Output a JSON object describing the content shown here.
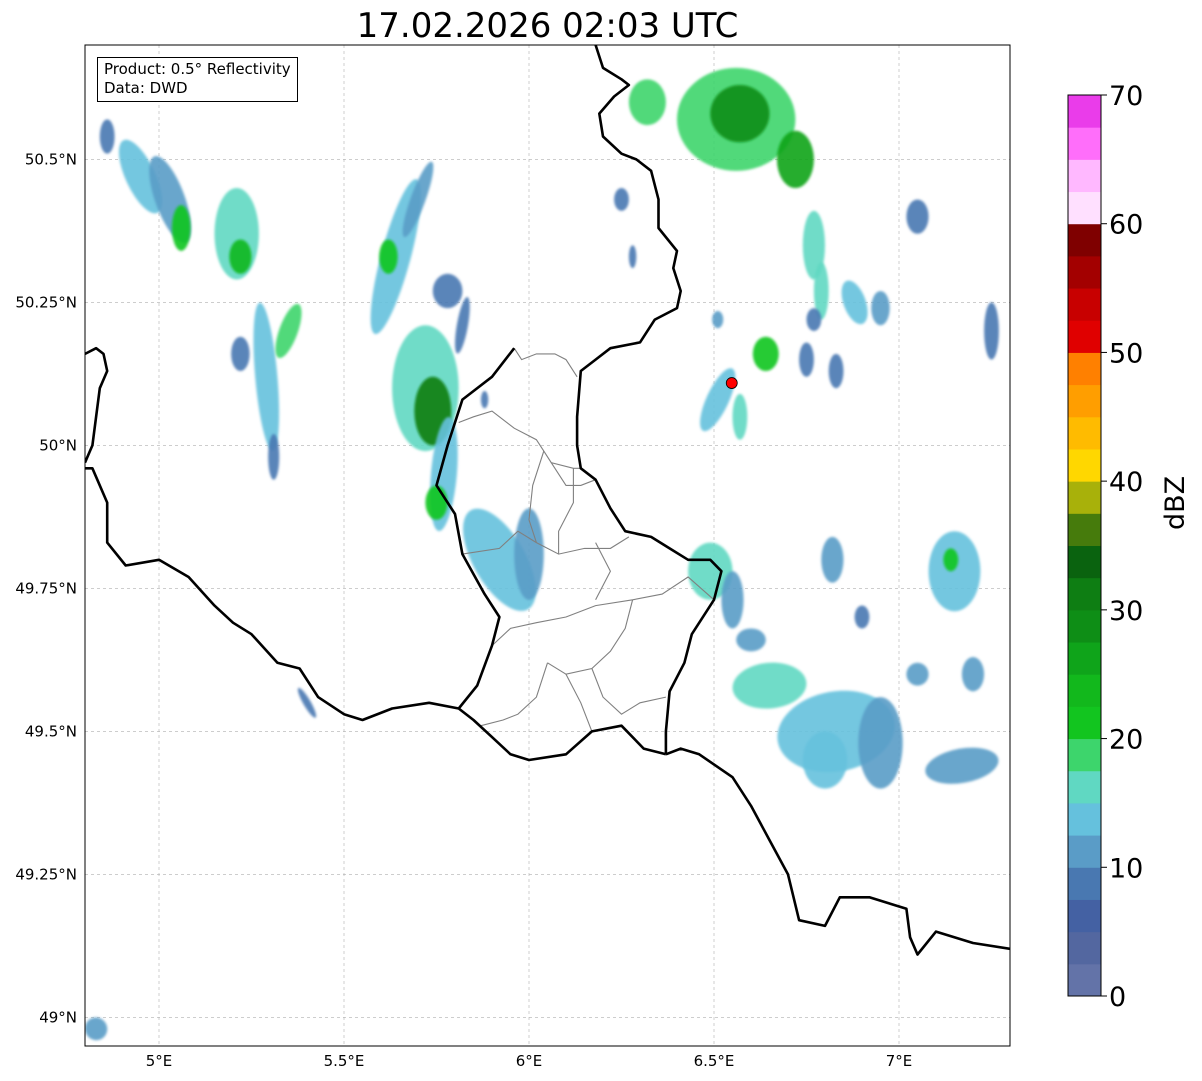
{
  "title": "17.02.2026 02:03 UTC",
  "info_box": {
    "product": "Product: 0.5° Reflectivity",
    "data": "Data: DWD"
  },
  "map": {
    "lon_range": [
      4.8,
      7.3
    ],
    "lat_range": [
      48.95,
      50.7
    ],
    "x_ticks": [
      {
        "value": 5.0,
        "label": "5°E"
      },
      {
        "value": 5.5,
        "label": "5.5°E"
      },
      {
        "value": 6.0,
        "label": "6°E"
      },
      {
        "value": 6.5,
        "label": "6.5°E"
      },
      {
        "value": 7.0,
        "label": "7°E"
      }
    ],
    "y_ticks": [
      {
        "value": 50.5,
        "label": "50.5°N"
      },
      {
        "value": 50.25,
        "label": "50.25°N"
      },
      {
        "value": 50.0,
        "label": "50°N"
      },
      {
        "value": 49.75,
        "label": "49.75°N"
      },
      {
        "value": 49.5,
        "label": "49.5°N"
      },
      {
        "value": 49.25,
        "label": "49.25°N"
      },
      {
        "value": 49.0,
        "label": "49°N"
      }
    ],
    "grid": true,
    "radar_site": {
      "lon": 6.548,
      "lat": 50.109,
      "color": "#ff0000"
    },
    "country_borders": [
      [
        [
          6.18,
          50.7
        ],
        [
          6.2,
          50.66
        ],
        [
          6.25,
          50.64
        ],
        [
          6.27,
          50.63
        ],
        [
          6.23,
          50.61
        ],
        [
          6.19,
          50.58
        ],
        [
          6.2,
          50.54
        ],
        [
          6.25,
          50.51
        ],
        [
          6.29,
          50.5
        ],
        [
          6.33,
          50.48
        ],
        [
          6.35,
          50.43
        ],
        [
          6.35,
          50.38
        ],
        [
          6.4,
          50.34
        ],
        [
          6.39,
          50.31
        ],
        [
          6.41,
          50.27
        ],
        [
          6.4,
          50.24
        ],
        [
          6.34,
          50.22
        ],
        [
          6.3,
          50.18
        ],
        [
          6.22,
          50.17
        ],
        [
          6.18,
          50.15
        ],
        [
          6.14,
          50.13
        ],
        [
          6.13,
          50.05
        ],
        [
          6.13,
          50.0
        ],
        [
          6.14,
          49.96
        ],
        [
          6.18,
          49.94
        ],
        [
          6.22,
          49.89
        ],
        [
          6.26,
          49.85
        ],
        [
          6.33,
          49.84
        ],
        [
          6.38,
          49.82
        ],
        [
          6.43,
          49.8
        ],
        [
          6.49,
          49.8
        ],
        [
          6.52,
          49.78
        ],
        [
          6.5,
          49.73
        ],
        [
          6.44,
          49.67
        ],
        [
          6.42,
          49.62
        ],
        [
          6.38,
          49.57
        ],
        [
          6.37,
          49.5
        ],
        [
          6.37,
          49.46
        ]
      ],
      [
        [
          6.37,
          49.46
        ],
        [
          6.31,
          49.47
        ],
        [
          6.25,
          49.51
        ],
        [
          6.17,
          49.5
        ],
        [
          6.1,
          49.46
        ],
        [
          6.0,
          49.45
        ],
        [
          5.95,
          49.46
        ],
        [
          5.9,
          49.49
        ],
        [
          5.85,
          49.52
        ],
        [
          5.81,
          49.54
        ],
        [
          5.73,
          49.55
        ],
        [
          5.63,
          49.54
        ],
        [
          5.55,
          49.52
        ],
        [
          5.5,
          49.53
        ],
        [
          5.43,
          49.56
        ],
        [
          5.38,
          49.61
        ],
        [
          5.32,
          49.62
        ],
        [
          5.25,
          49.67
        ],
        [
          5.2,
          49.69
        ],
        [
          5.15,
          49.72
        ],
        [
          5.08,
          49.77
        ],
        [
          5.0,
          49.8
        ],
        [
          4.91,
          49.79
        ],
        [
          4.86,
          49.83
        ],
        [
          4.86,
          49.9
        ],
        [
          4.82,
          49.96
        ],
        [
          4.8,
          49.96
        ]
      ],
      [
        [
          5.96,
          50.17
        ],
        [
          5.9,
          50.12
        ],
        [
          5.82,
          50.08
        ],
        [
          5.78,
          50.0
        ],
        [
          5.75,
          49.93
        ],
        [
          5.8,
          49.88
        ],
        [
          5.82,
          49.81
        ],
        [
          5.88,
          49.74
        ],
        [
          5.92,
          49.7
        ],
        [
          5.9,
          49.65
        ],
        [
          5.86,
          49.58
        ],
        [
          5.81,
          49.54
        ]
      ],
      [
        [
          4.8,
          50.16
        ],
        [
          4.83,
          50.17
        ],
        [
          4.85,
          50.16
        ],
        [
          4.86,
          50.13
        ],
        [
          4.84,
          50.1
        ],
        [
          4.83,
          50.05
        ],
        [
          4.82,
          50.0
        ],
        [
          4.8,
          49.97
        ]
      ],
      [
        [
          6.37,
          49.46
        ],
        [
          6.41,
          49.47
        ],
        [
          6.46,
          49.46
        ],
        [
          6.55,
          49.42
        ],
        [
          6.6,
          49.37
        ],
        [
          6.65,
          49.31
        ],
        [
          6.7,
          49.25
        ],
        [
          6.73,
          49.17
        ],
        [
          6.8,
          49.16
        ],
        [
          6.84,
          49.21
        ],
        [
          6.92,
          49.21
        ],
        [
          6.97,
          49.2
        ],
        [
          7.02,
          49.19
        ],
        [
          7.03,
          49.14
        ],
        [
          7.05,
          49.11
        ],
        [
          7.1,
          49.15
        ],
        [
          7.2,
          49.13
        ],
        [
          7.3,
          49.12
        ]
      ]
    ],
    "internal_borders": [
      [
        [
          5.96,
          50.17
        ],
        [
          5.98,
          50.15
        ],
        [
          6.02,
          50.16
        ],
        [
          6.07,
          50.16
        ],
        [
          6.1,
          50.15
        ],
        [
          6.13,
          50.12
        ]
      ],
      [
        [
          5.81,
          50.04
        ],
        [
          5.85,
          50.05
        ],
        [
          5.9,
          50.06
        ],
        [
          5.92,
          50.05
        ],
        [
          5.96,
          50.03
        ],
        [
          6.02,
          50.01
        ],
        [
          6.04,
          49.99
        ],
        [
          6.06,
          49.97
        ],
        [
          6.12,
          49.96
        ],
        [
          6.14,
          49.96
        ]
      ],
      [
        [
          6.06,
          49.97
        ],
        [
          6.1,
          49.93
        ],
        [
          6.14,
          49.93
        ],
        [
          6.18,
          49.94
        ]
      ],
      [
        [
          5.82,
          49.81
        ],
        [
          5.92,
          49.82
        ],
        [
          5.97,
          49.85
        ],
        [
          6.02,
          49.83
        ],
        [
          6.08,
          49.81
        ],
        [
          6.15,
          49.82
        ],
        [
          6.22,
          49.82
        ],
        [
          6.27,
          49.84
        ]
      ],
      [
        [
          6.04,
          49.99
        ],
        [
          6.01,
          49.93
        ],
        [
          6.0,
          49.87
        ],
        [
          6.02,
          49.83
        ]
      ],
      [
        [
          5.9,
          49.65
        ],
        [
          5.95,
          49.68
        ],
        [
          6.02,
          49.69
        ],
        [
          6.1,
          49.7
        ],
        [
          6.18,
          49.72
        ],
        [
          6.28,
          49.73
        ],
        [
          6.36,
          49.74
        ],
        [
          6.43,
          49.77
        ],
        [
          6.5,
          49.73
        ]
      ],
      [
        [
          6.28,
          49.73
        ],
        [
          6.26,
          49.68
        ],
        [
          6.22,
          49.64
        ],
        [
          6.17,
          49.61
        ],
        [
          6.1,
          49.6
        ],
        [
          6.05,
          49.62
        ]
      ],
      [
        [
          6.17,
          49.61
        ],
        [
          6.2,
          49.56
        ],
        [
          6.25,
          49.53
        ],
        [
          6.3,
          49.55
        ],
        [
          6.37,
          49.56
        ]
      ],
      [
        [
          6.05,
          49.62
        ],
        [
          6.02,
          49.56
        ],
        [
          5.97,
          49.53
        ],
        [
          5.93,
          49.52
        ],
        [
          5.87,
          49.51
        ]
      ],
      [
        [
          6.1,
          49.6
        ],
        [
          6.14,
          49.55
        ],
        [
          6.17,
          49.5
        ]
      ],
      [
        [
          6.18,
          49.83
        ],
        [
          6.22,
          49.78
        ],
        [
          6.18,
          49.73
        ]
      ],
      [
        [
          6.12,
          49.96
        ],
        [
          6.12,
          49.9
        ],
        [
          6.08,
          49.85
        ],
        [
          6.08,
          49.81
        ]
      ]
    ],
    "echoes": [
      {
        "lon": 4.95,
        "lat": 50.47,
        "rx": 0.04,
        "ry": 0.07,
        "rot": -25,
        "dbz": 14
      },
      {
        "lon": 5.03,
        "lat": 50.43,
        "rx": 0.04,
        "ry": 0.08,
        "rot": -20,
        "dbz": 12
      },
      {
        "lon": 5.06,
        "lat": 50.38,
        "rx": 0.025,
        "ry": 0.04,
        "rot": 0,
        "dbz": 20
      },
      {
        "lon": 4.86,
        "lat": 50.54,
        "rx": 0.02,
        "ry": 0.03,
        "rot": 0,
        "dbz": 8
      },
      {
        "lon": 5.21,
        "lat": 50.37,
        "rx": 0.06,
        "ry": 0.08,
        "rot": 0,
        "dbz": 15
      },
      {
        "lon": 5.22,
        "lat": 50.33,
        "rx": 0.03,
        "ry": 0.03,
        "rot": 0,
        "dbz": 23
      },
      {
        "lon": 5.29,
        "lat": 50.12,
        "rx": 0.03,
        "ry": 0.13,
        "rot": -5,
        "dbz": 14
      },
      {
        "lon": 5.22,
        "lat": 50.16,
        "rx": 0.025,
        "ry": 0.03,
        "rot": 0,
        "dbz": 8
      },
      {
        "lon": 5.35,
        "lat": 50.2,
        "rx": 0.025,
        "ry": 0.05,
        "rot": 20,
        "dbz": 18
      },
      {
        "lon": 5.31,
        "lat": 49.98,
        "rx": 0.015,
        "ry": 0.04,
        "rot": 0,
        "dbz": 8
      },
      {
        "lon": 5.64,
        "lat": 50.33,
        "rx": 0.04,
        "ry": 0.14,
        "rot": 15,
        "dbz": 13
      },
      {
        "lon": 5.62,
        "lat": 50.33,
        "rx": 0.025,
        "ry": 0.03,
        "rot": 0,
        "dbz": 21
      },
      {
        "lon": 5.7,
        "lat": 50.43,
        "rx": 0.02,
        "ry": 0.07,
        "rot": 20,
        "dbz": 10
      },
      {
        "lon": 5.72,
        "lat": 50.1,
        "rx": 0.09,
        "ry": 0.11,
        "rot": 0,
        "dbz": 16
      },
      {
        "lon": 5.74,
        "lat": 50.06,
        "rx": 0.05,
        "ry": 0.06,
        "rot": 0,
        "dbz": 30
      },
      {
        "lon": 5.77,
        "lat": 49.95,
        "rx": 0.035,
        "ry": 0.1,
        "rot": 5,
        "dbz": 14
      },
      {
        "lon": 5.75,
        "lat": 49.9,
        "rx": 0.03,
        "ry": 0.03,
        "rot": 0,
        "dbz": 21
      },
      {
        "lon": 5.92,
        "lat": 49.8,
        "rx": 0.07,
        "ry": 0.1,
        "rot": -30,
        "dbz": 13
      },
      {
        "lon": 6.0,
        "lat": 49.81,
        "rx": 0.04,
        "ry": 0.08,
        "rot": 0,
        "dbz": 12
      },
      {
        "lon": 5.78,
        "lat": 50.27,
        "rx": 0.04,
        "ry": 0.03,
        "rot": 0,
        "dbz": 8
      },
      {
        "lon": 5.82,
        "lat": 50.21,
        "rx": 0.015,
        "ry": 0.05,
        "rot": 10,
        "dbz": 8
      },
      {
        "lon": 6.56,
        "lat": 50.57,
        "rx": 0.16,
        "ry": 0.09,
        "rot": 0,
        "dbz": 18
      },
      {
        "lon": 6.57,
        "lat": 50.58,
        "rx": 0.08,
        "ry": 0.05,
        "rot": 0,
        "dbz": 28
      },
      {
        "lon": 6.72,
        "lat": 50.5,
        "rx": 0.05,
        "ry": 0.05,
        "rot": 0,
        "dbz": 27
      },
      {
        "lon": 6.32,
        "lat": 50.6,
        "rx": 0.05,
        "ry": 0.04,
        "rot": 0,
        "dbz": 18
      },
      {
        "lon": 6.77,
        "lat": 50.35,
        "rx": 0.03,
        "ry": 0.06,
        "rot": 0,
        "dbz": 15
      },
      {
        "lon": 6.79,
        "lat": 50.27,
        "rx": 0.02,
        "ry": 0.05,
        "rot": 0,
        "dbz": 16
      },
      {
        "lon": 6.88,
        "lat": 50.25,
        "rx": 0.03,
        "ry": 0.04,
        "rot": -20,
        "dbz": 14
      },
      {
        "lon": 6.95,
        "lat": 50.24,
        "rx": 0.025,
        "ry": 0.03,
        "rot": 0,
        "dbz": 10
      },
      {
        "lon": 7.05,
        "lat": 50.4,
        "rx": 0.03,
        "ry": 0.03,
        "rot": 0,
        "dbz": 8
      },
      {
        "lon": 6.64,
        "lat": 50.16,
        "rx": 0.035,
        "ry": 0.03,
        "rot": 0,
        "dbz": 20
      },
      {
        "lon": 6.51,
        "lat": 50.22,
        "rx": 0.015,
        "ry": 0.015,
        "rot": 0,
        "dbz": 12
      },
      {
        "lon": 6.51,
        "lat": 50.08,
        "rx": 0.03,
        "ry": 0.06,
        "rot": 25,
        "dbz": 14
      },
      {
        "lon": 6.57,
        "lat": 50.05,
        "rx": 0.02,
        "ry": 0.04,
        "rot": 0,
        "dbz": 16
      },
      {
        "lon": 6.75,
        "lat": 50.15,
        "rx": 0.02,
        "ry": 0.03,
        "rot": 0,
        "dbz": 8
      },
      {
        "lon": 6.49,
        "lat": 49.78,
        "rx": 0.06,
        "ry": 0.05,
        "rot": 0,
        "dbz": 16
      },
      {
        "lon": 6.55,
        "lat": 49.73,
        "rx": 0.03,
        "ry": 0.05,
        "rot": 0,
        "dbz": 10
      },
      {
        "lon": 6.6,
        "lat": 49.66,
        "rx": 0.04,
        "ry": 0.02,
        "rot": 0,
        "dbz": 10
      },
      {
        "lon": 6.65,
        "lat": 49.58,
        "rx": 0.1,
        "ry": 0.04,
        "rot": -5,
        "dbz": 15
      },
      {
        "lon": 6.83,
        "lat": 49.5,
        "rx": 0.16,
        "ry": 0.07,
        "rot": -10,
        "dbz": 14
      },
      {
        "lon": 6.8,
        "lat": 49.45,
        "rx": 0.06,
        "ry": 0.05,
        "rot": 0,
        "dbz": 14
      },
      {
        "lon": 6.95,
        "lat": 49.48,
        "rx": 0.06,
        "ry": 0.08,
        "rot": 0,
        "dbz": 10
      },
      {
        "lon": 7.17,
        "lat": 49.44,
        "rx": 0.1,
        "ry": 0.03,
        "rot": -10,
        "dbz": 10
      },
      {
        "lon": 7.15,
        "lat": 49.78,
        "rx": 0.07,
        "ry": 0.07,
        "rot": 0,
        "dbz": 14
      },
      {
        "lon": 7.14,
        "lat": 49.8,
        "rx": 0.02,
        "ry": 0.02,
        "rot": 0,
        "dbz": 22
      },
      {
        "lon": 6.82,
        "lat": 49.8,
        "rx": 0.03,
        "ry": 0.04,
        "rot": 0,
        "dbz": 10
      },
      {
        "lon": 7.05,
        "lat": 49.6,
        "rx": 0.03,
        "ry": 0.02,
        "rot": 0,
        "dbz": 12
      },
      {
        "lon": 7.2,
        "lat": 49.6,
        "rx": 0.03,
        "ry": 0.03,
        "rot": 0,
        "dbz": 10
      },
      {
        "lon": 6.77,
        "lat": 50.22,
        "rx": 0.02,
        "ry": 0.02,
        "rot": 0,
        "dbz": 8
      },
      {
        "lon": 6.83,
        "lat": 50.13,
        "rx": 0.02,
        "ry": 0.03,
        "rot": 0,
        "dbz": 8
      },
      {
        "lon": 4.83,
        "lat": 48.98,
        "rx": 0.03,
        "ry": 0.02,
        "rot": -25,
        "dbz": 10
      },
      {
        "lon": 5.4,
        "lat": 49.55,
        "rx": 0.01,
        "ry": 0.03,
        "rot": -30,
        "dbz": 8
      },
      {
        "lon": 6.25,
        "lat": 50.43,
        "rx": 0.02,
        "ry": 0.02,
        "rot": 0,
        "dbz": 8
      },
      {
        "lon": 7.25,
        "lat": 50.2,
        "rx": 0.02,
        "ry": 0.05,
        "rot": 0,
        "dbz": 8
      },
      {
        "lon": 5.88,
        "lat": 50.08,
        "rx": 0.01,
        "ry": 0.015,
        "rot": 0,
        "dbz": 8
      },
      {
        "lon": 6.28,
        "lat": 50.33,
        "rx": 0.01,
        "ry": 0.02,
        "rot": 0,
        "dbz": 8
      },
      {
        "lon": 6.9,
        "lat": 49.7,
        "rx": 0.02,
        "ry": 0.02,
        "rot": 0,
        "dbz": 8
      }
    ]
  },
  "colorbar": {
    "label": "dBZ",
    "min": 0,
    "max": 70,
    "step": 2.5,
    "colors": [
      "#6373a8",
      "#5367a0",
      "#4461a3",
      "#4978b1",
      "#5a9cc7",
      "#65c1dd",
      "#60d8c2",
      "#3dd56c",
      "#12c51f",
      "#12b81c",
      "#0fa41a",
      "#0e8e16",
      "#0e7e13",
      "#0a630f",
      "#467b0c",
      "#a8b10a",
      "#ffd700",
      "#ffbb00",
      "#ff9e00",
      "#ff8000",
      "#e00000",
      "#c80000",
      "#a30000",
      "#7f0000",
      "#ffe0ff",
      "#ffb8ff",
      "#ff6efa",
      "#ea3cea"
    ],
    "tick_labels": [
      {
        "value": 0,
        "label": "0"
      },
      {
        "value": 10,
        "label": "10"
      },
      {
        "value": 20,
        "label": "20"
      },
      {
        "value": 30,
        "label": "30"
      },
      {
        "value": 40,
        "label": "40"
      },
      {
        "value": 50,
        "label": "50"
      },
      {
        "value": 60,
        "label": "60"
      },
      {
        "value": 70,
        "label": "70"
      }
    ]
  }
}
